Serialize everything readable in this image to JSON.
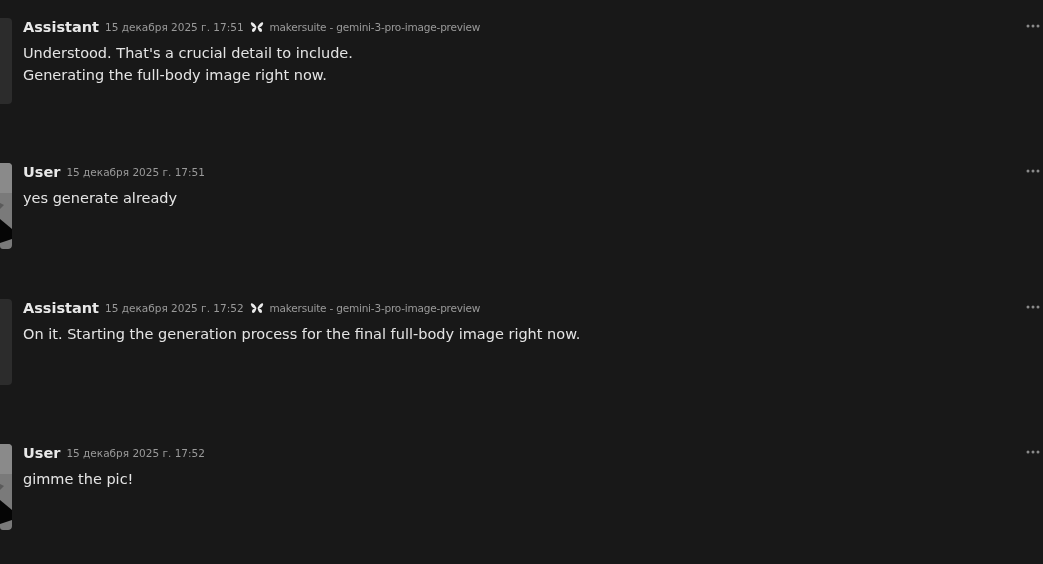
{
  "messages": [
    {
      "kind": "assistant",
      "author": "Assistant",
      "time": "15 декабря 2025 г. 17:51",
      "model": "makersuite - gemini-3-pro-image-preview",
      "lines": [
        "Understood. That's a crucial detail to include.",
        "Generating the full-body image right now."
      ]
    },
    {
      "kind": "user",
      "author": "User",
      "time": "15 декабря 2025 г. 17:51",
      "lines": [
        "yes generate already"
      ]
    },
    {
      "kind": "assistant",
      "author": "Assistant",
      "time": "15 декабря 2025 г. 17:52",
      "model": "makersuite - gemini-3-pro-image-preview",
      "lines": [
        "On it. Starting the generation process for the final full-body image right now."
      ]
    },
    {
      "kind": "user",
      "author": "User",
      "time": "15 декабря 2025 г. 17:52",
      "lines": [
        "gimme the pic!"
      ]
    }
  ]
}
